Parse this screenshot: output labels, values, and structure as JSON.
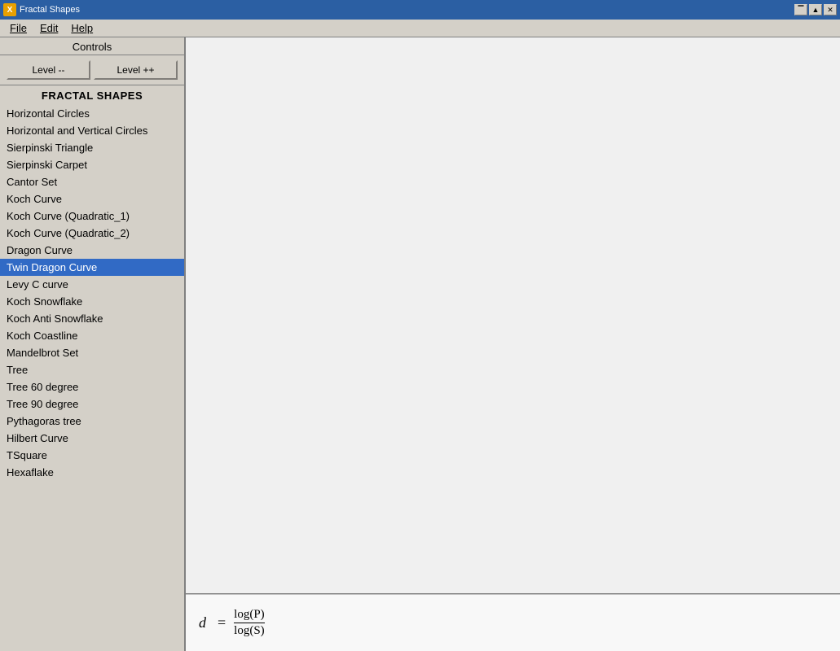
{
  "titlebar": {
    "title": "Fractal Shapes",
    "icon_label": "X",
    "minimize_label": "▔",
    "maximize_label": "▲",
    "close_label": "✕"
  },
  "menubar": {
    "items": [
      {
        "label": "File",
        "underline": "F"
      },
      {
        "label": "Edit",
        "underline": "E"
      },
      {
        "label": "Help",
        "underline": "H"
      }
    ]
  },
  "sidebar": {
    "controls_label": "Controls",
    "level_decrease_label": "Level --",
    "level_increase_label": "Level ++",
    "fractal_shapes_header": "FRACTAL SHAPES",
    "shapes": [
      {
        "label": "Horizontal Circles",
        "selected": false
      },
      {
        "label": "Horizontal and Vertical Circles",
        "selected": false
      },
      {
        "label": "Sierpinski Triangle",
        "selected": false
      },
      {
        "label": "Sierpinski Carpet",
        "selected": false
      },
      {
        "label": "Cantor Set",
        "selected": false
      },
      {
        "label": "Koch Curve",
        "selected": false
      },
      {
        "label": "Koch Curve (Quadratic_1)",
        "selected": false
      },
      {
        "label": "Koch Curve (Quadratic_2)",
        "selected": false
      },
      {
        "label": "Dragon Curve",
        "selected": false
      },
      {
        "label": "Twin Dragon Curve",
        "selected": true
      },
      {
        "label": "Levy C curve",
        "selected": false
      },
      {
        "label": "Koch Snowflake",
        "selected": false
      },
      {
        "label": "Koch Anti Snowflake",
        "selected": false
      },
      {
        "label": "Koch Coastline",
        "selected": false
      },
      {
        "label": "Mandelbrot Set",
        "selected": false
      },
      {
        "label": "Tree",
        "selected": false
      },
      {
        "label": "Tree 60 degree",
        "selected": false
      },
      {
        "label": "Tree 90 degree",
        "selected": false
      },
      {
        "label": "Pythagoras tree",
        "selected": false
      },
      {
        "label": "Hilbert Curve",
        "selected": false
      },
      {
        "label": "TSquare",
        "selected": false
      },
      {
        "label": "Hexaflake",
        "selected": false
      }
    ]
  },
  "formula": {
    "d": "d",
    "equals": "=",
    "numerator": "log(P)",
    "denominator": "log(S)"
  }
}
